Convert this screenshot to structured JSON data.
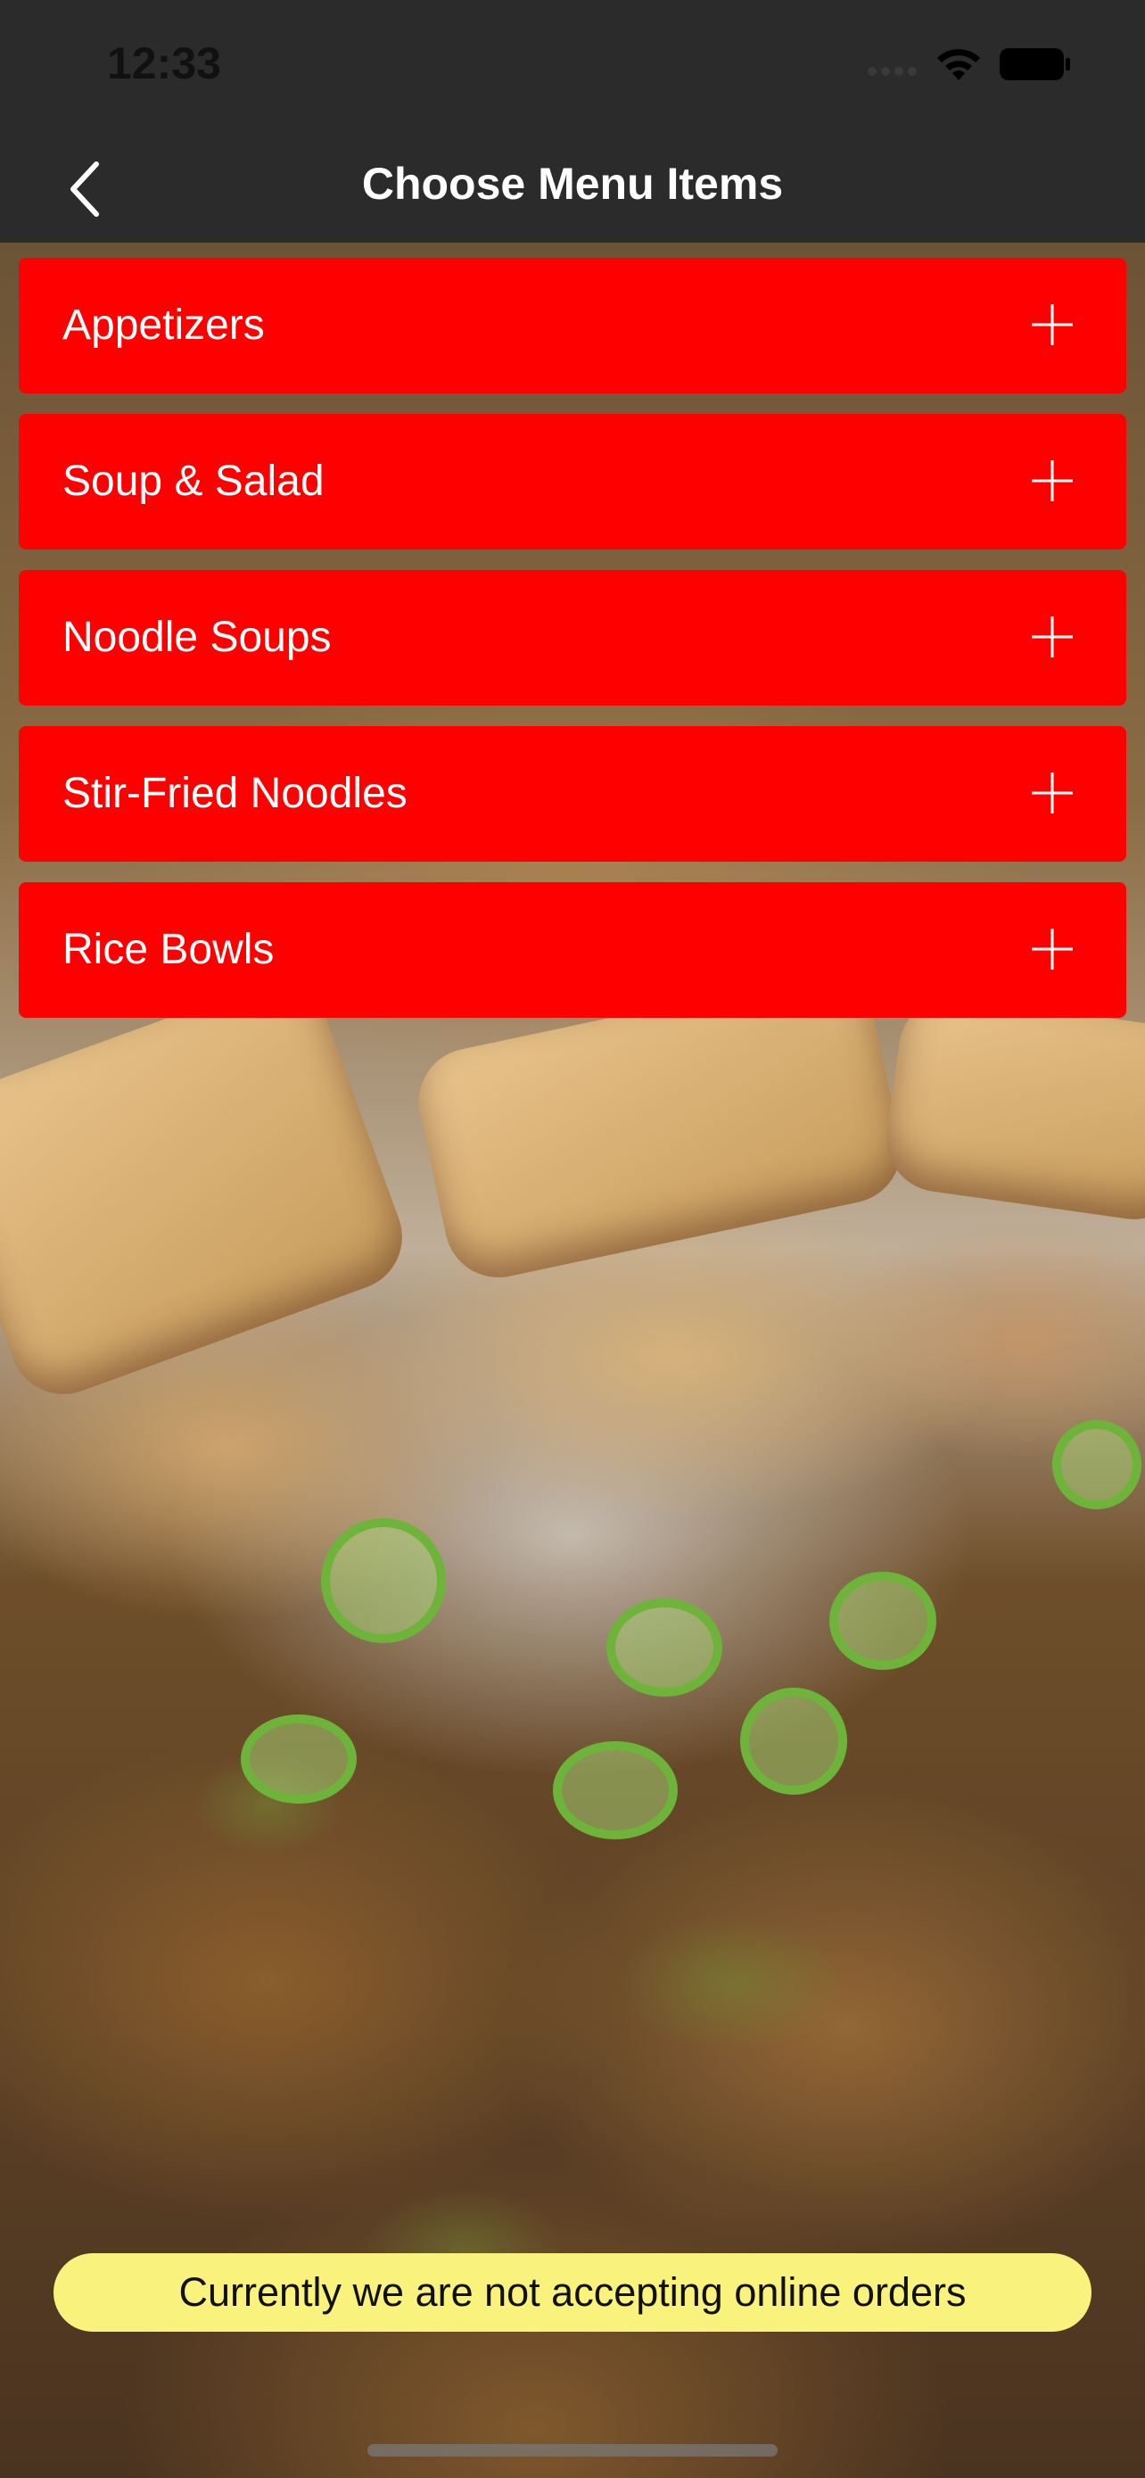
{
  "status_bar": {
    "time": "12:33",
    "signal_icon": "cellular-signal-icon",
    "wifi_icon": "wifi-icon",
    "battery_icon": "battery-icon"
  },
  "nav": {
    "title": "Choose Menu Items",
    "back_icon": "chevron-left-icon"
  },
  "menu_items": [
    {
      "label": "Appetizers"
    },
    {
      "label": "Soup & Salad"
    },
    {
      "label": "Noodle Soups"
    },
    {
      "label": "Stir-Fried Noodles"
    },
    {
      "label": "Rice Bowls"
    }
  ],
  "notice": {
    "text": "Currently we are not accepting online orders"
  },
  "colors": {
    "accent": "#ff0000",
    "notice_bg": "#f9f27d",
    "bar_bg": "#2b2b2b"
  }
}
